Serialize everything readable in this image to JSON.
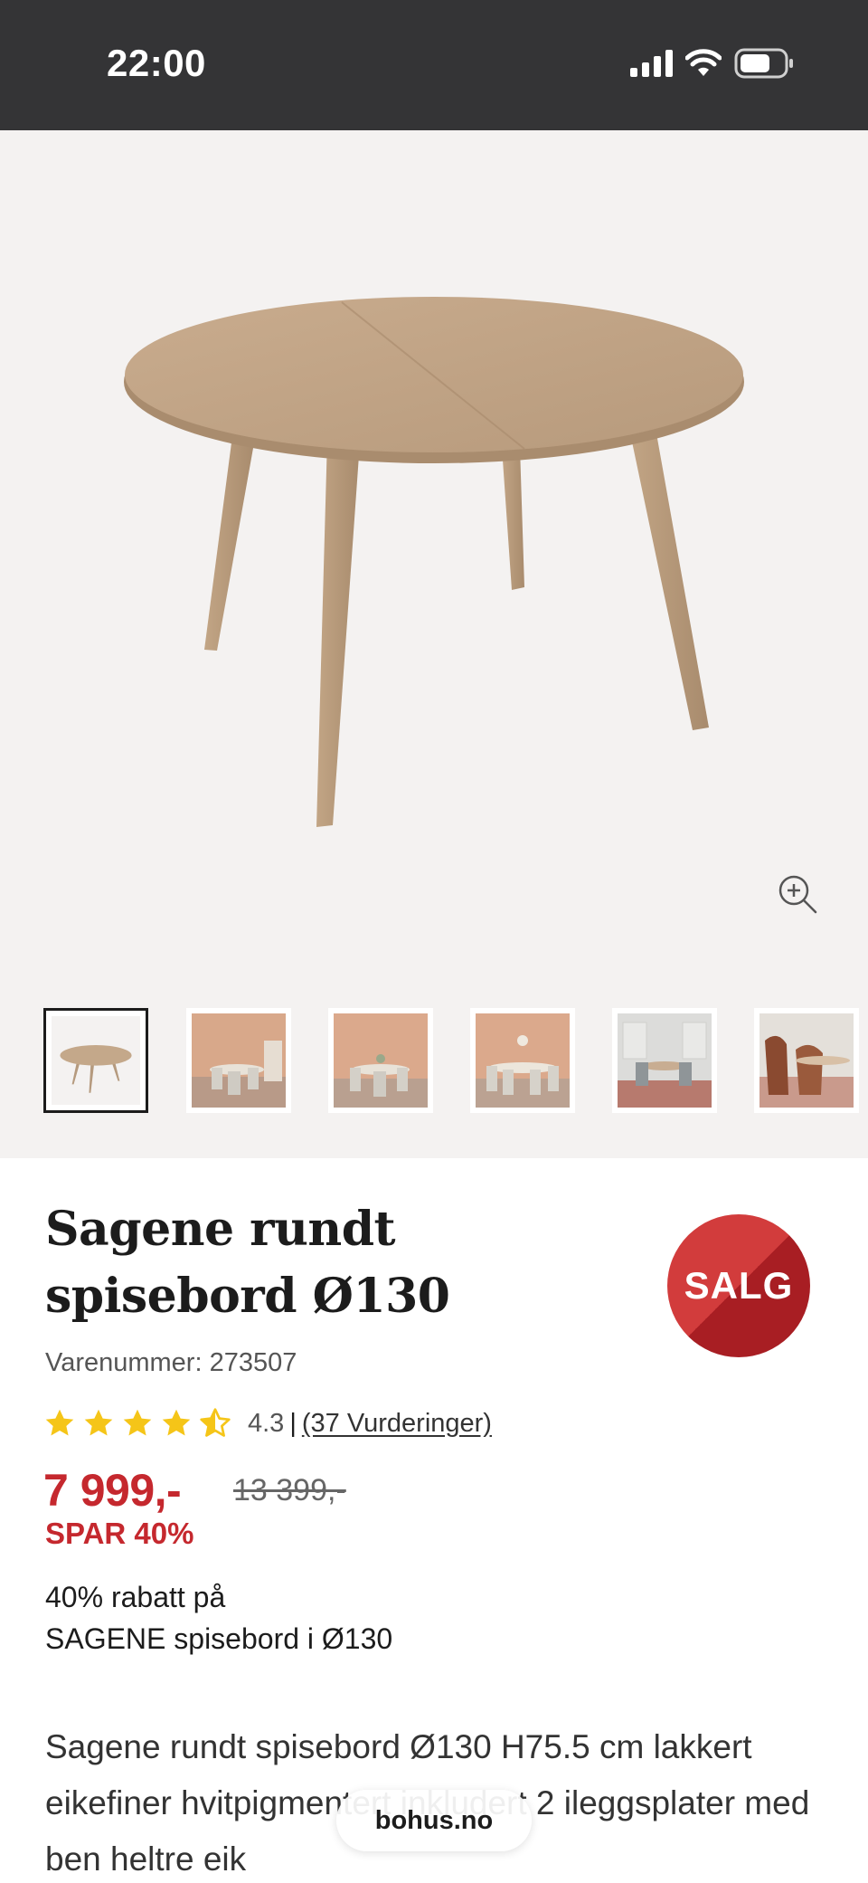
{
  "status_bar": {
    "time": "22:00",
    "icons": [
      "cellular-signal-icon",
      "wifi-icon",
      "battery-icon"
    ]
  },
  "gallery": {
    "main_image": "round oak dining table",
    "zoom_icon": "zoom-in-icon",
    "thumbnails": [
      {
        "name": "table-product",
        "active": true
      },
      {
        "name": "room-scene-1",
        "active": false
      },
      {
        "name": "room-scene-2",
        "active": false
      },
      {
        "name": "room-scene-3",
        "active": false
      },
      {
        "name": "room-scene-4",
        "active": false
      },
      {
        "name": "room-scene-5",
        "active": false
      }
    ]
  },
  "product": {
    "title": "Sagene rundt spisebord Ø130",
    "sku": "Varenummer: 273507",
    "badge": "SALG",
    "rating": {
      "value": "4.3",
      "stars": 4.3,
      "separator": "|",
      "reviews_link": "(37 Vurderinger)"
    },
    "price": "7 999,-",
    "old_price": "13 399,-",
    "save": "SPAR 40%",
    "promo_line1": "40% rabatt på",
    "promo_line2": "SAGENE spisebord i Ø130",
    "description": "Sagene rundt spisebord Ø130 H75.5 cm lakkert eikefiner hvitpigmentert inkludert 2 ileggsplater med ben heltre eik"
  },
  "browser": {
    "url": "bohus.no"
  },
  "colors": {
    "accent_red": "#c5282e",
    "star_yellow": "#f5c518",
    "status_bar_bg": "#343436"
  }
}
